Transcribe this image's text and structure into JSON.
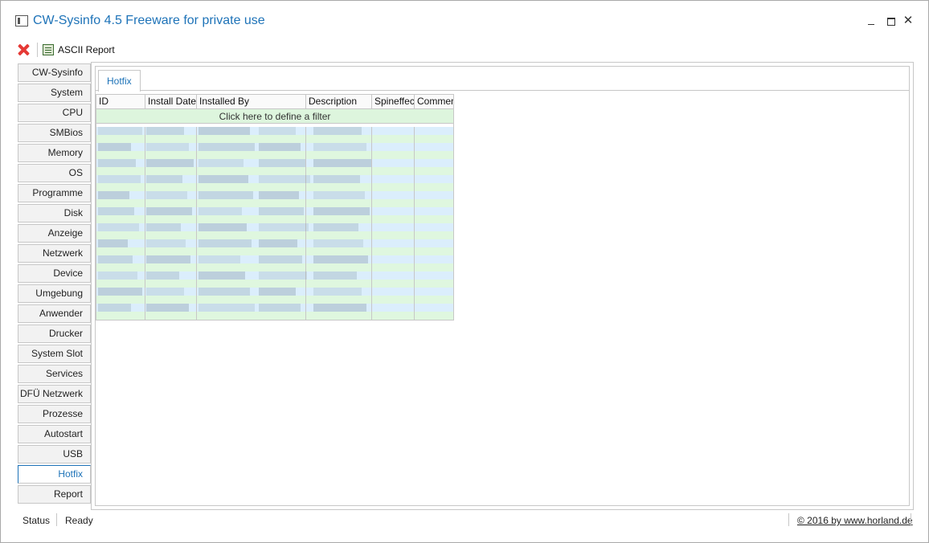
{
  "window": {
    "title": "CW-Sysinfo 4.5 Freeware for private use"
  },
  "toolbar": {
    "close_icon": "red-x-icon",
    "report_icon": "report-icon",
    "report_label": "ASCII Report"
  },
  "nav": {
    "items": [
      {
        "label": "CW-Sysinfo",
        "active": false
      },
      {
        "label": "System",
        "active": false
      },
      {
        "label": "CPU",
        "active": false
      },
      {
        "label": "SMBios",
        "active": false
      },
      {
        "label": "Memory",
        "active": false
      },
      {
        "label": "OS",
        "active": false
      },
      {
        "label": "Programme",
        "active": false
      },
      {
        "label": "Disk",
        "active": false
      },
      {
        "label": "Anzeige",
        "active": false
      },
      {
        "label": "Netzwerk",
        "active": false
      },
      {
        "label": "Device",
        "active": false
      },
      {
        "label": "Umgebung",
        "active": false
      },
      {
        "label": "Anwender",
        "active": false
      },
      {
        "label": "Drucker",
        "active": false
      },
      {
        "label": "System Slot",
        "active": false
      },
      {
        "label": "Services",
        "active": false
      },
      {
        "label": "DFÜ Netzwerk",
        "active": false
      },
      {
        "label": "Prozesse",
        "active": false
      },
      {
        "label": "Autostart",
        "active": false
      },
      {
        "label": "USB",
        "active": false
      },
      {
        "label": "Hotfix",
        "active": true
      },
      {
        "label": "Report",
        "active": false
      }
    ]
  },
  "main": {
    "tab_label": "Hotfix",
    "grid": {
      "columns": [
        "ID",
        "Install Date",
        "Installed By",
        "Description",
        "Spineffect",
        "Comment"
      ],
      "filter_text": "Click here to define a filter"
    }
  },
  "status": {
    "label": "Status",
    "text": "Ready",
    "copyright": "© 2016 by www.horland.de"
  },
  "colors": {
    "accent": "#1e73b8",
    "row_even": "#dbeefc",
    "row_odd": "#dff7df",
    "filter_bg": "#ddf5dd",
    "close_red": "#e53935"
  }
}
